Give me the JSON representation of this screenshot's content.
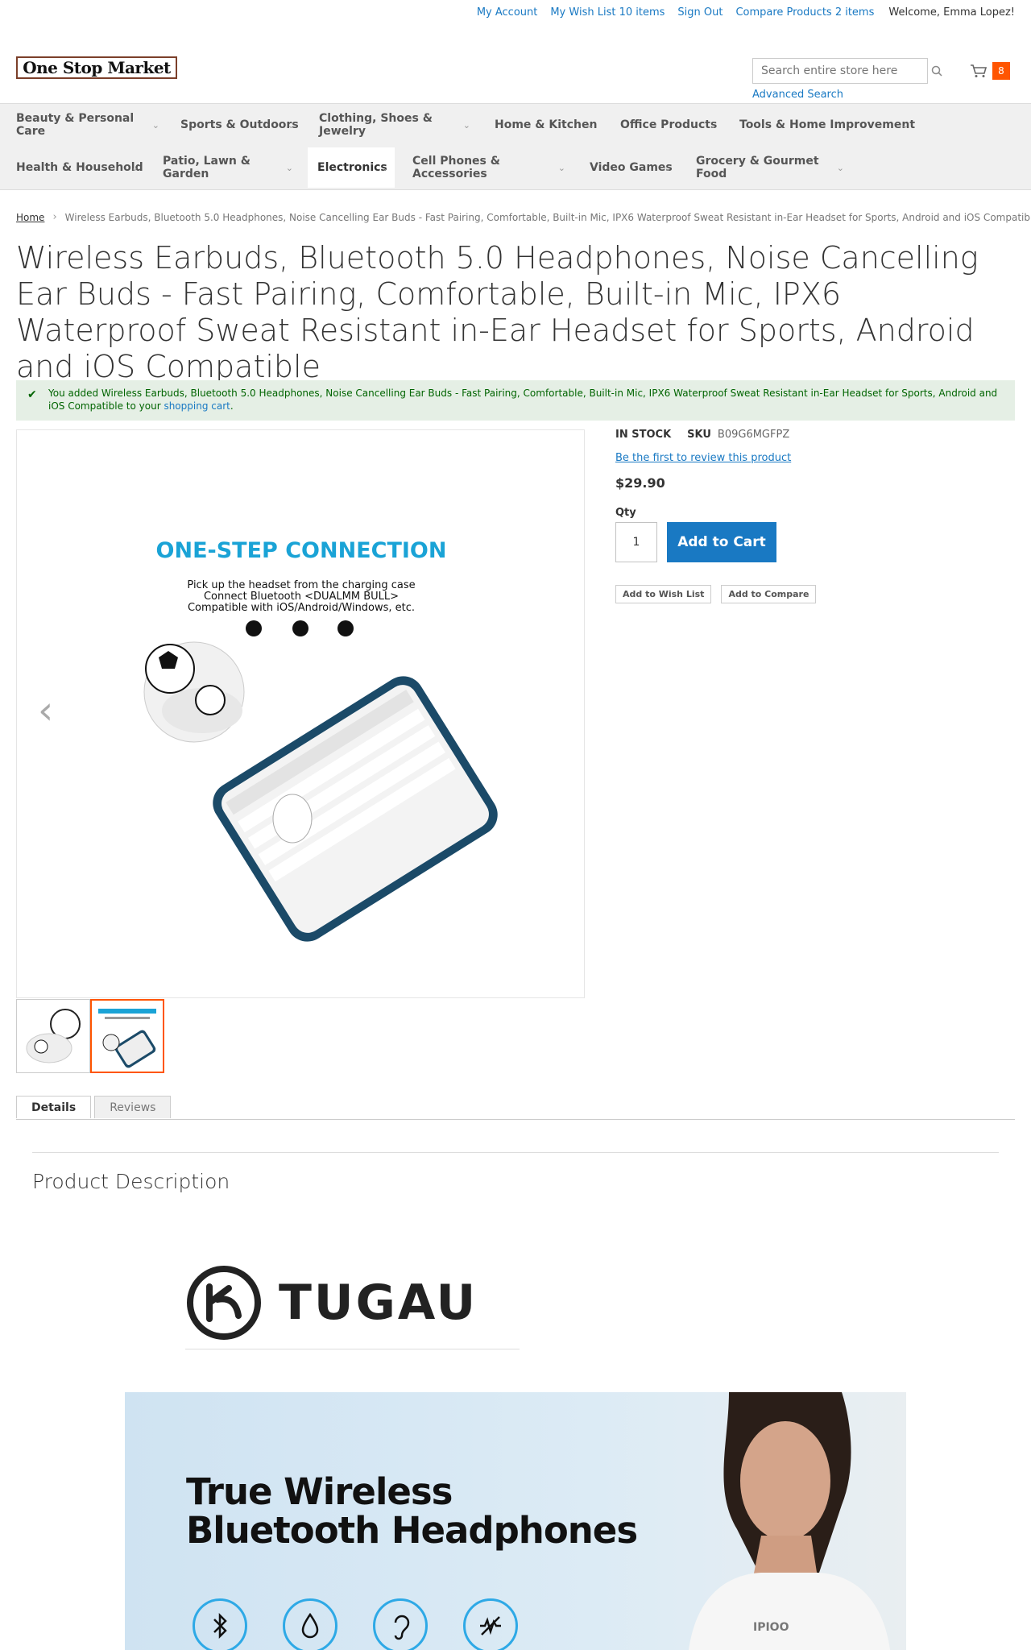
{
  "header": {
    "links": {
      "my_account": "My Account",
      "wish_list": "My Wish List 10 items",
      "sign_out": "Sign Out",
      "compare": "Compare Products 2 items"
    },
    "welcome": "Welcome, Emma Lopez!",
    "logo": "One Stop Market",
    "search_placeholder": "Search entire store here...",
    "advanced_search": "Advanced Search",
    "cart_count": "8"
  },
  "nav": {
    "row1": [
      "Beauty & Personal Care",
      "Sports & Outdoors",
      "Clothing, Shoes & Jewelry",
      "Home & Kitchen",
      "Office Products",
      "Tools & Home Improvement"
    ],
    "row2": [
      "Health & Household",
      "Patio, Lawn & Garden",
      "Electronics",
      "Cell Phones & Accessories",
      "Video Games",
      "Grocery & Gourmet Food"
    ]
  },
  "breadcrumb": {
    "home": "Home",
    "current": "Wireless Earbuds, Bluetooth 5.0 Headphones, Noise Cancelling Ear Buds - Fast Pairing, Comfortable, Built-in Mic, IPX6 Waterproof Sweat Resistant in-Ear Headset for Sports, Android and iOS Compatible"
  },
  "product": {
    "title": "Wireless Earbuds, Bluetooth 5.0 Headphones, Noise Cancelling Ear Buds - Fast Pairing, Comfortable, Built-in Mic, IPX6 Waterproof Sweat Resistant in-Ear Headset for Sports, Android and iOS Compatible",
    "stock": "IN STOCK",
    "sku_label": "SKU",
    "sku": "B09G6MGFPZ",
    "review_link": "Be the first to review this product",
    "price": "$29.90",
    "qty_label": "Qty",
    "qty": "1",
    "add_to_cart": "Add to Cart",
    "add_to_wishlist": "Add to Wish List",
    "add_to_compare": "Add to Compare"
  },
  "message": {
    "text": "You added Wireless Earbuds, Bluetooth 5.0 Headphones, Noise Cancelling Ear Buds - Fast Pairing, Comfortable, Built-in Mic, IPX6 Waterproof Sweat Resistant in-Ear Headset for Sports, Android and iOS Compatible to your",
    "link": "shopping cart",
    "tail": "."
  },
  "gallery": {
    "heading": "ONE-STEP CONNECTION",
    "line1": "Pick up the headset from the charging case",
    "line2": "Connect Bluetooth <DUALMM BULL>",
    "line3": "Compatible with iOS/Android/Windows, etc."
  },
  "tabs": {
    "details": "Details",
    "reviews": "Reviews"
  },
  "description": {
    "title": "Product Description",
    "brand": "TUGAU",
    "banner_line1": "True Wireless",
    "banner_line2": "Bluetooth Headphones",
    "shirt_text": "IPIOO"
  },
  "colors": {
    "link": "#1979c3",
    "accent": "#ff5501",
    "cta": "#1979c3",
    "success_bg": "#e5efe5"
  }
}
